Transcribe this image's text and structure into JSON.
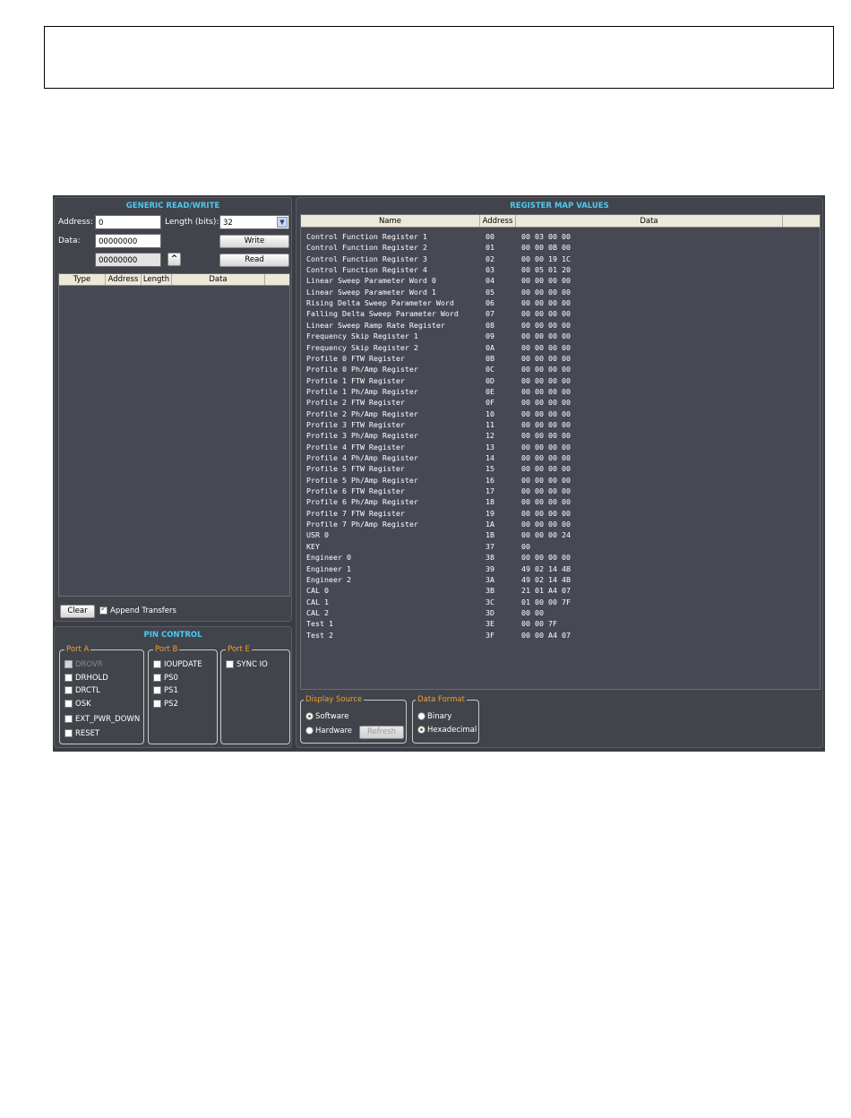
{
  "generic": {
    "title": "GENERIC READ/WRITE",
    "address_label": "Address:",
    "address_value": "0",
    "length_label": "Length (bits):",
    "length_value": "32",
    "data_label": "Data:",
    "data_value": "00000000",
    "read_value": "00000000",
    "write_label": "Write",
    "read_label": "Read",
    "columns": [
      "Type",
      "Address",
      "Length",
      "Data"
    ],
    "clear_label": "Clear",
    "append_label": "Append Transfers",
    "append_checked": true
  },
  "pin": {
    "title": "PIN CONTROL",
    "port_a": {
      "title": "Port A",
      "items": [
        {
          "label": "DROVR",
          "checked": false,
          "disabled": true
        },
        {
          "label": "DRHOLD",
          "checked": false,
          "disabled": false
        },
        {
          "label": "DRCTL",
          "checked": false,
          "disabled": false
        },
        {
          "label": "OSK",
          "checked": false,
          "disabled": false
        },
        {
          "label": "EXT_PWR_DOWN",
          "checked": false,
          "disabled": false
        },
        {
          "label": "RESET",
          "checked": false,
          "disabled": false
        }
      ]
    },
    "port_b": {
      "title": "Port B",
      "items": [
        {
          "label": "IOUPDATE",
          "checked": false,
          "disabled": false
        },
        {
          "label": "PS0",
          "checked": false,
          "disabled": false
        },
        {
          "label": "PS1",
          "checked": false,
          "disabled": false
        },
        {
          "label": "PS2",
          "checked": false,
          "disabled": false
        }
      ]
    },
    "port_e": {
      "title": "Port E",
      "items": [
        {
          "label": "SYNC IO",
          "checked": false,
          "disabled": false
        }
      ]
    }
  },
  "regmap": {
    "title": "REGISTER MAP VALUES",
    "columns": [
      "Name",
      "Address",
      "Data"
    ],
    "rows": [
      {
        "name": "Control Function Register 1",
        "address": "00",
        "data": "00 03 00 00"
      },
      {
        "name": "Control Function Register 2",
        "address": "01",
        "data": "00 00 0B 00"
      },
      {
        "name": "Control Function Register 3",
        "address": "02",
        "data": "00 00 19 1C"
      },
      {
        "name": "Control Function Register 4",
        "address": "03",
        "data": "00 05 01 20"
      },
      {
        "name": "Linear Sweep Parameter Word 0",
        "address": "04",
        "data": "00 00 00 00"
      },
      {
        "name": "Linear Sweep Parameter Word 1",
        "address": "05",
        "data": "00 00 00 00"
      },
      {
        "name": "Rising Delta Sweep Parameter Word",
        "address": "06",
        "data": "00 00 00 00"
      },
      {
        "name": "Falling Delta Sweep Parameter Word",
        "address": "07",
        "data": "00 00 00 00"
      },
      {
        "name": "Linear Sweep Ramp Rate Register",
        "address": "08",
        "data": "00 00 00 00"
      },
      {
        "name": "Frequency Skip Register 1",
        "address": "09",
        "data": "00 00 00 00"
      },
      {
        "name": "Frequency Skip Register 2",
        "address": "0A",
        "data": "00 00 00 00"
      },
      {
        "name": "Profile 0 FTW Register",
        "address": "0B",
        "data": "00 00 00 00"
      },
      {
        "name": "Profile 0 Ph/Amp Register",
        "address": "0C",
        "data": "00 00 00 00"
      },
      {
        "name": "Profile 1 FTW Register",
        "address": "0D",
        "data": "00 00 00 00"
      },
      {
        "name": "Profile 1 Ph/Amp Register",
        "address": "0E",
        "data": "00 00 00 00"
      },
      {
        "name": "Profile 2 FTW Register",
        "address": "0F",
        "data": "00 00 00 00"
      },
      {
        "name": "Profile 2 Ph/Amp Register",
        "address": "10",
        "data": "00 00 00 00"
      },
      {
        "name": "Profile 3 FTW Register",
        "address": "11",
        "data": "00 00 00 00"
      },
      {
        "name": "Profile 3 Ph/Amp Register",
        "address": "12",
        "data": "00 00 00 00"
      },
      {
        "name": "Profile 4 FTW Register",
        "address": "13",
        "data": "00 00 00 00"
      },
      {
        "name": "Profile 4 Ph/Amp Register",
        "address": "14",
        "data": "00 00 00 00"
      },
      {
        "name": "Profile 5 FTW Register",
        "address": "15",
        "data": "00 00 00 00"
      },
      {
        "name": "Profile 5 Ph/Amp Register",
        "address": "16",
        "data": "00 00 00 00"
      },
      {
        "name": "Profile 6 FTW Register",
        "address": "17",
        "data": "00 00 00 00"
      },
      {
        "name": "Profile 6 Ph/Amp Register",
        "address": "18",
        "data": "00 00 00 00"
      },
      {
        "name": "Profile 7 FTW Register",
        "address": "19",
        "data": "00 00 00 00"
      },
      {
        "name": "Profile 7 Ph/Amp Register",
        "address": "1A",
        "data": "00 00 00 00"
      },
      {
        "name": "USR 0",
        "address": "1B",
        "data": "00 00 00 24"
      },
      {
        "name": "KEY",
        "address": "37",
        "data": "00"
      },
      {
        "name": "Engineer 0",
        "address": "38",
        "data": "00 00 00 00"
      },
      {
        "name": "Engineer 1",
        "address": "39",
        "data": "49 02 14 4B"
      },
      {
        "name": "Engineer 2",
        "address": "3A",
        "data": "49 02 14 4B"
      },
      {
        "name": "CAL 0",
        "address": "3B",
        "data": "21 01 A4 07"
      },
      {
        "name": "CAL 1",
        "address": "3C",
        "data": "01 00 00 7F"
      },
      {
        "name": "CAL 2",
        "address": "3D",
        "data": "00 00"
      },
      {
        "name": "Test 1",
        "address": "3E",
        "data": "00 00 7F"
      },
      {
        "name": "Test 2",
        "address": "3F",
        "data": "00 00 A4 07"
      }
    ]
  },
  "display_source": {
    "title": "Display Source",
    "software_label": "Software",
    "hardware_label": "Hardware",
    "selected": "software",
    "refresh_label": "Refresh"
  },
  "data_format": {
    "title": "Data Format",
    "binary_label": "Binary",
    "hex_label": "Hexadecimal",
    "selected": "hexadecimal"
  },
  "colors": {
    "title_accent": "#4ec9f0",
    "group_title": "#f0a030",
    "panel_bg": "#41444b",
    "list_bg": "#464954"
  }
}
